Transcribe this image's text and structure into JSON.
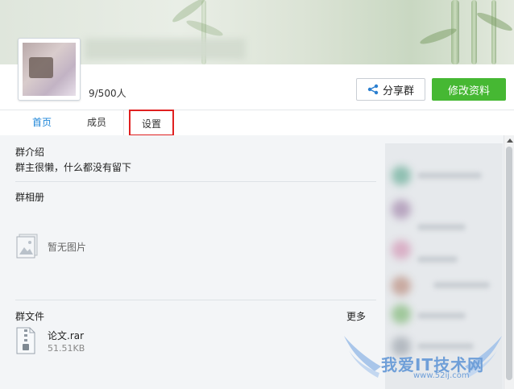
{
  "header": {
    "member_count": "9/500人",
    "share_label": "分享群",
    "edit_label": "修改资料"
  },
  "tabs": [
    {
      "label": "首页",
      "active": true
    },
    {
      "label": "成员",
      "active": false
    },
    {
      "label": "设置",
      "active": false,
      "highlighted": true
    }
  ],
  "intro": {
    "title": "群介绍",
    "text": "群主很懒，什么都没有留下"
  },
  "album": {
    "title": "群相册",
    "empty_text": "暂无图片"
  },
  "files": {
    "title": "群文件",
    "more_label": "更多",
    "items": [
      {
        "name": "论文.rar",
        "size": "51.51KB"
      }
    ]
  },
  "watermark": {
    "text": "我爱IT技术网",
    "url": "www.52ij.com"
  },
  "colors": {
    "accent_blue": "#1f86d8",
    "primary_green": "#46b833",
    "highlight_red": "#e02020",
    "watermark_blue": "#6f9fd8"
  },
  "icons": [
    "share-icon",
    "image-placeholder-icon",
    "zip-file-icon",
    "scroll-up-icon"
  ]
}
